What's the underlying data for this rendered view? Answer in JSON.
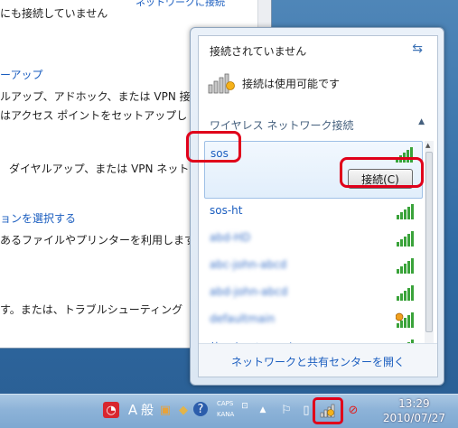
{
  "background_window": {
    "top_line": "にも接続していません",
    "top_link": "ネットワークに接続",
    "link1": "ーアップ",
    "line2": "ルアップ、アドホック、または VPN 接続",
    "line3": "はアクセス ポイントをセットアップし",
    "line4": "ダイヤルアップ、または VPN ネット",
    "link2": "ョンを選択する",
    "line5": "あるファイルやプリンターを利用します",
    "line6": "す。または、トラブルシューティング"
  },
  "flyout": {
    "status": "接続されていません",
    "refresh_icon": "refresh-icon",
    "available_text": "接続は使用可能です",
    "section_label": "ワイヤレス ネットワーク接続",
    "networks": [
      {
        "name": "sos",
        "selected": true,
        "connect_label": "接続(C)"
      },
      {
        "name": "sos-ht"
      },
      {
        "name": "abd-HD"
      },
      {
        "name": "abc-john-abcd"
      },
      {
        "name": "abd-john-abcd"
      },
      {
        "name": "defaultmain"
      },
      {
        "name": "他のネットワーク"
      }
    ],
    "footer_link": "ネットワークと共有センターを開く"
  },
  "taskbar": {
    "ime_mode": "A",
    "ime_kanji": "般",
    "caps": "CAPS",
    "kana": "KANA",
    "time": "13:29",
    "date": "2010/07/27"
  },
  "colors": {
    "highlight": "#e0001a",
    "link": "#1a5dbf",
    "signal": "#3aa33a"
  }
}
